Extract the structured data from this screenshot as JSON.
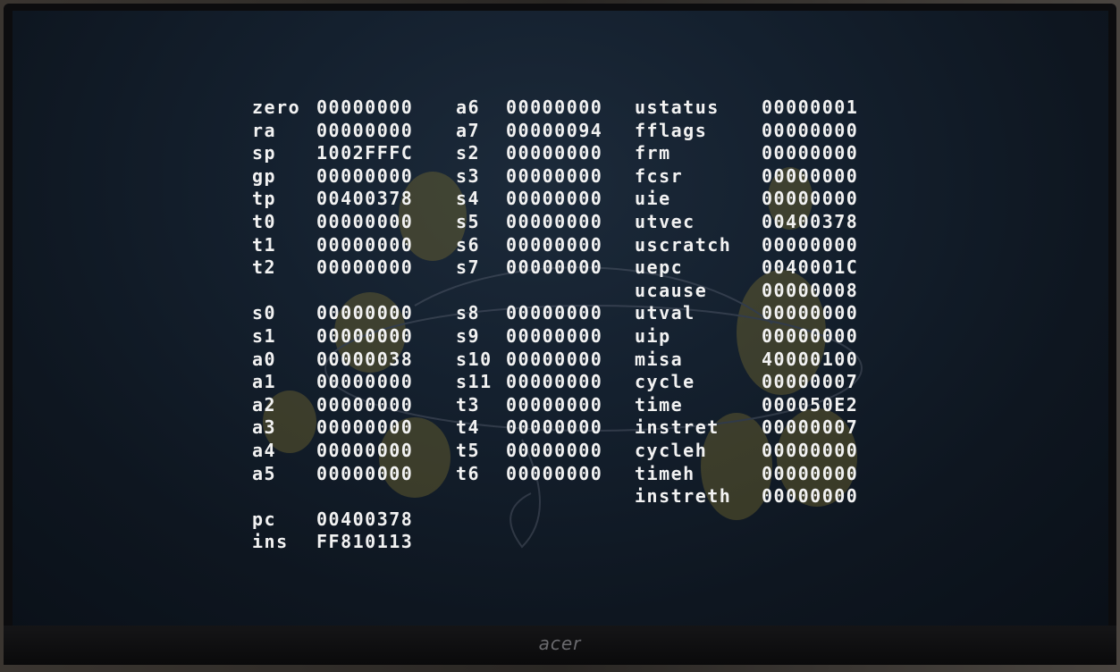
{
  "brand": {
    "logo": "acer"
  },
  "registers": {
    "column1": [
      {
        "name": "zero",
        "value": "00000000"
      },
      {
        "name": "ra",
        "value": "00000000"
      },
      {
        "name": "sp",
        "value": "1002FFFC"
      },
      {
        "name": "gp",
        "value": "00000000"
      },
      {
        "name": "tp",
        "value": "00400378"
      },
      {
        "name": "t0",
        "value": "00000000"
      },
      {
        "name": "t1",
        "value": "00000000"
      },
      {
        "name": "t2",
        "value": "00000000"
      },
      {
        "name": "",
        "value": ""
      },
      {
        "name": "s0",
        "value": "00000000"
      },
      {
        "name": "s1",
        "value": "00000000"
      },
      {
        "name": "a0",
        "value": "00000038"
      },
      {
        "name": "a1",
        "value": "00000000"
      },
      {
        "name": "a2",
        "value": "00000000"
      },
      {
        "name": "a3",
        "value": "00000000"
      },
      {
        "name": "a4",
        "value": "00000000"
      },
      {
        "name": "a5",
        "value": "00000000"
      },
      {
        "name": "",
        "value": ""
      },
      {
        "name": "pc",
        "value": "00400378"
      },
      {
        "name": "ins",
        "value": "FF810113"
      }
    ],
    "column2": [
      {
        "name": "a6",
        "value": "00000000"
      },
      {
        "name": "a7",
        "value": "00000094"
      },
      {
        "name": "s2",
        "value": "00000000"
      },
      {
        "name": "s3",
        "value": "00000000"
      },
      {
        "name": "s4",
        "value": "00000000"
      },
      {
        "name": "s5",
        "value": "00000000"
      },
      {
        "name": "s6",
        "value": "00000000"
      },
      {
        "name": "s7",
        "value": "00000000"
      },
      {
        "name": "",
        "value": ""
      },
      {
        "name": "s8",
        "value": "00000000"
      },
      {
        "name": "s9",
        "value": "00000000"
      },
      {
        "name": "s10",
        "value": "00000000"
      },
      {
        "name": "s11",
        "value": "00000000"
      },
      {
        "name": "t3",
        "value": "00000000"
      },
      {
        "name": "t4",
        "value": "00000000"
      },
      {
        "name": "t5",
        "value": "00000000"
      },
      {
        "name": "t6",
        "value": "00000000"
      }
    ],
    "column3": [
      {
        "name": "ustatus",
        "value": "00000001"
      },
      {
        "name": "fflags",
        "value": "00000000"
      },
      {
        "name": "frm",
        "value": "00000000"
      },
      {
        "name": "fcsr",
        "value": "00000000"
      },
      {
        "name": "uie",
        "value": "00000000"
      },
      {
        "name": "utvec",
        "value": "00400378"
      },
      {
        "name": "uscratch",
        "value": "00000000"
      },
      {
        "name": "uepc",
        "value": "0040001C"
      },
      {
        "name": "ucause",
        "value": "00000008"
      },
      {
        "name": "utval",
        "value": "00000000"
      },
      {
        "name": "uip",
        "value": "00000000"
      },
      {
        "name": "misa",
        "value": "40000100"
      },
      {
        "name": "cycle",
        "value": "00000007"
      },
      {
        "name": "time",
        "value": "000050E2"
      },
      {
        "name": "instret",
        "value": "00000007"
      },
      {
        "name": "cycleh",
        "value": "00000000"
      },
      {
        "name": "timeh",
        "value": "00000000"
      },
      {
        "name": "instreth",
        "value": "00000000"
      }
    ]
  }
}
